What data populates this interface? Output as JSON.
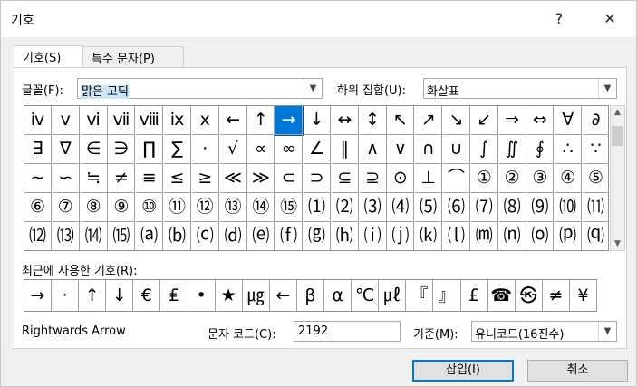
{
  "window": {
    "title": "기호",
    "help_label": "?",
    "close_label": "✕"
  },
  "tabs": [
    {
      "label": "기호(S)"
    },
    {
      "label": "특수 문자(P)"
    }
  ],
  "font": {
    "label": "글꼴(F):",
    "value": "맑은 고딕"
  },
  "subset": {
    "label": "하위 집합(U):",
    "value": "화살표"
  },
  "symbols": [
    [
      "ⅳ",
      "ⅴ",
      "ⅵ",
      "ⅶ",
      "ⅷ",
      "ⅸ",
      "ⅹ",
      "←",
      "↑",
      "→",
      "↓",
      "↔",
      "↕",
      "↖",
      "↗",
      "↘",
      "↙",
      "⇒",
      "⇔",
      "∀",
      "∂"
    ],
    [
      "∃",
      "∇",
      "∈",
      "∋",
      "∏",
      "∑",
      "·",
      "√",
      "∝",
      "∞",
      "∠",
      "‖",
      "∧",
      "∨",
      "∩",
      "∪",
      "∫",
      "∬",
      "∮",
      "∴",
      "∵"
    ],
    [
      "∼",
      "∽",
      "≒",
      "≠",
      "≡",
      "≤",
      "≥",
      "≪",
      "≫",
      "⊂",
      "⊃",
      "⊆",
      "⊇",
      "⊙",
      "⊥",
      "⌒",
      "①",
      "②",
      "③",
      "④",
      "⑤"
    ],
    [
      "⑥",
      "⑦",
      "⑧",
      "⑨",
      "⑩",
      "⑪",
      "⑫",
      "⑬",
      "⑭",
      "⑮",
      "⑴",
      "⑵",
      "⑶",
      "⑷",
      "⑸",
      "⑹",
      "⑺",
      "⑻",
      "⑼",
      "⑽",
      "⑾"
    ],
    [
      "⑿",
      "⒀",
      "⒁",
      "⒂",
      "⒜",
      "⒝",
      "⒞",
      "⒟",
      "⒠",
      "⒡",
      "⒢",
      "⒣",
      "⒤",
      "⒥",
      "⒦",
      "⒧",
      "⒨",
      "⒩",
      "⒪",
      "⒫",
      "⒬"
    ]
  ],
  "selected": {
    "row": 0,
    "col": 9
  },
  "recent": {
    "label": "최근에 사용한 기호(R):",
    "items": [
      "→",
      "·",
      "↑",
      "↓",
      "€",
      "₤",
      "•",
      "★",
      "㎍",
      "←",
      "β",
      "α",
      "℃",
      "㎕",
      "『",
      "』",
      "£",
      "☎",
      "㉿",
      "≠",
      "¥"
    ]
  },
  "char_name": "Rightwards Arrow",
  "char_code": {
    "label": "문자 코드(C):",
    "value": "2192"
  },
  "basis": {
    "label": "기준(M):",
    "value": "유니코드(16진수)"
  },
  "buttons": {
    "insert": "삽입(I)",
    "cancel": "취소"
  }
}
